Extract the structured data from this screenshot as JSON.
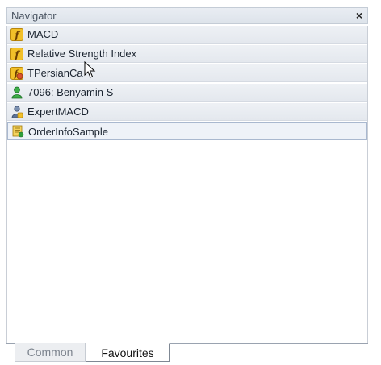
{
  "panel": {
    "title": "Navigator",
    "close_glyph": "×"
  },
  "items": [
    {
      "label": "MACD",
      "icon": "indicator-icon"
    },
    {
      "label": "Relative Strength Index",
      "icon": "indicator-icon"
    },
    {
      "label": "TPersianCa",
      "icon": "custom-indicator-icon"
    },
    {
      "label": "7096: Benyamin S",
      "icon": "account-icon"
    },
    {
      "label": "ExpertMACD",
      "icon": "expert-advisor-icon"
    },
    {
      "label": "OrderInfoSample",
      "icon": "script-icon"
    }
  ],
  "tabs": [
    {
      "label": "Common",
      "active": false
    },
    {
      "label": "Favourites",
      "active": true
    }
  ],
  "colors": {
    "indicator": "#e8b321",
    "account": "#2f9e3a",
    "selected_border": "#a9b8cf"
  }
}
